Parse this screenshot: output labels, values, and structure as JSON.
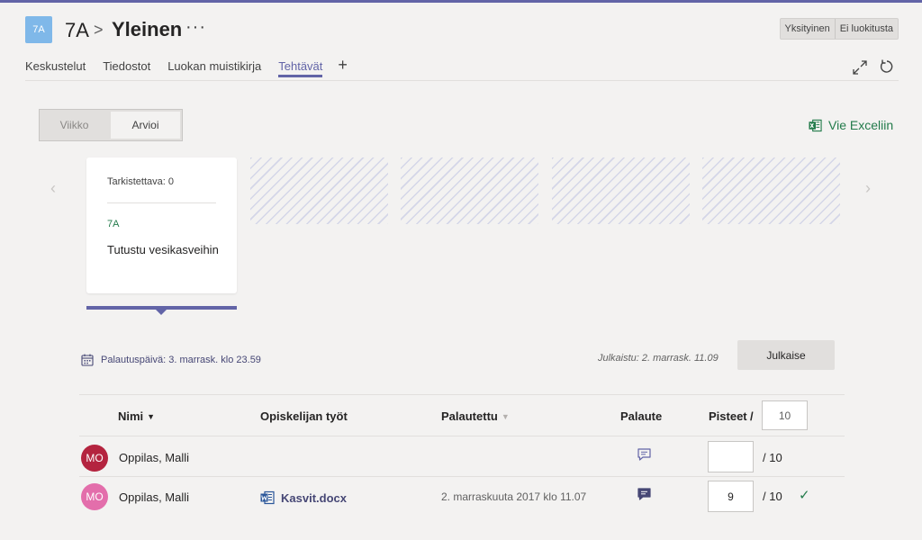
{
  "header": {
    "team_tile": "7A",
    "team_name": "7A",
    "separator": ">",
    "channel_name": "Yleinen",
    "more": "···",
    "badges": [
      "Yksityinen",
      "Ei luokitusta"
    ]
  },
  "tabs": [
    {
      "label": "Keskustelut"
    },
    {
      "label": "Tiedostot"
    },
    {
      "label": "Luokan muistikirja"
    },
    {
      "label": "Tehtävät",
      "active": true
    }
  ],
  "tab_add": "+",
  "view_toggle": {
    "options": [
      "Viikko",
      "Arvioi"
    ],
    "selected": "Arvioi"
  },
  "export": {
    "label": "Vie Exceliin"
  },
  "carousel": {
    "prev": "‹",
    "next": "›",
    "card": {
      "review_count": "Tarkistettava: 0",
      "class": "7A",
      "title": "Tutustu vesikasveihin"
    }
  },
  "assignment": {
    "due": "Palautuspäivä: 3. marrask. klo 23.59",
    "published": "Julkaistu: 2. marrask. 11.09",
    "publish_button": "Julkaise"
  },
  "table": {
    "headers": {
      "name": "Nimi",
      "work": "Opiskelijan työt",
      "submitted": "Palautettu",
      "feedback": "Palaute",
      "points": "Pisteet",
      "points_sep": "/"
    },
    "sort_glyph": "▼",
    "max_points": "10",
    "rows": [
      {
        "initials": "MO",
        "avatar_color": "#b4243f",
        "name": "Oppilas, Malli",
        "file": "",
        "submitted": "",
        "feedback_filled": false,
        "score": "",
        "max": "/ 10",
        "check": ""
      },
      {
        "initials": "MO",
        "avatar_color": "#e36eab",
        "name": "Oppilas, Malli",
        "file": "Kasvit.docx",
        "submitted": "2. marraskuuta 2017 klo 11.07",
        "feedback_filled": true,
        "score": "9",
        "max": "/ 10",
        "check": "✓"
      }
    ]
  },
  "colors": {
    "accent": "#6264a7",
    "excel_green": "#237b4b"
  }
}
